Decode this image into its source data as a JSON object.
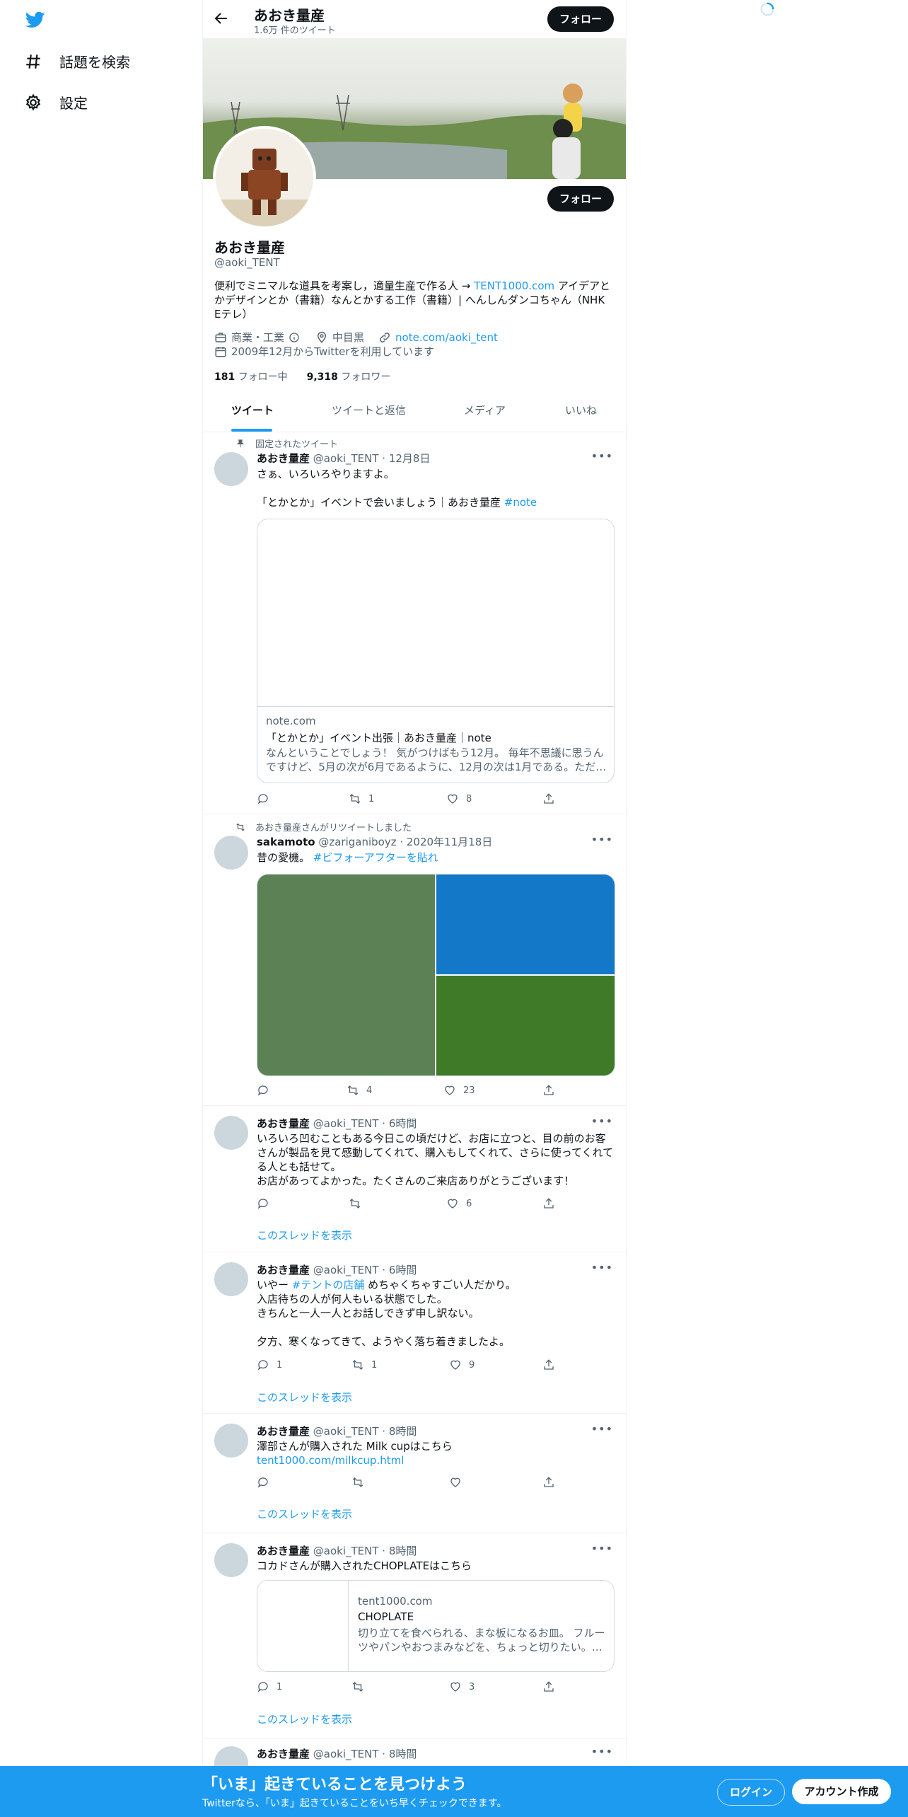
{
  "colors": {
    "accent": "#1d9bf0",
    "dark": "#0f1419",
    "muted": "#536471"
  },
  "nav": {
    "logo_icon": "twitter-bird-icon",
    "items": [
      {
        "icon": "hashtag-icon",
        "label": "話題を検索"
      },
      {
        "icon": "gear-icon",
        "label": "設定"
      }
    ]
  },
  "header": {
    "name": "あおき量産",
    "tweet_count": "1.6万 件のツイート",
    "follow": "フォロー"
  },
  "profile": {
    "name": "あおき量産",
    "handle": "@aoki_TENT",
    "follow": "フォロー",
    "bio_pre": "便利でミニマルな道具を考案し，適量生産で作る人 → ",
    "bio_link": "TENT1000.com",
    "bio_post": "  アイデアとかデザインとか（書籍）なんとかする工作（書籍）| へんしんダンコちゃん（NHK Eテレ）",
    "category": "商業・工業",
    "location": "中目黒",
    "website": "note.com/aoki_tent",
    "joined": "2009年12月からTwitterを利用しています",
    "following_count": "181",
    "following_label": "フォロー中",
    "followers_count": "9,318",
    "followers_label": "フォロワー"
  },
  "tabs": [
    "ツイート",
    "ツイートと返信",
    "メディア",
    "いいね"
  ],
  "tweets": [
    {
      "pinned_label": "固定されたツイート",
      "name": "あおき量産",
      "handle": "@aoki_TENT · 12月8日",
      "line1": "さぁ、いろいろやりますよ。",
      "line2": "「とかとか」イベントで会いましょう｜あおき量産 ",
      "hashtag": "#note",
      "card": {
        "domain": "note.com",
        "title": "「とかとか」イベント出張｜あおき量産｜note",
        "desc": "なんということでしょう！ 気がつけばもう12月。 毎年不思議に思うんですけど、5月の次が6月であるように、12月の次は1月である。ただ…"
      },
      "counts": {
        "reply": "",
        "retweet": "1",
        "like": "8"
      }
    },
    {
      "retweet_label": "あおき量産さんがリツイートしました",
      "name": "sakamoto",
      "handle": "@zariganiboyz · 2020年11月18日",
      "text": "昔の愛機。 ",
      "hashtag": "#ビフォーアフターを貼れ",
      "media_colors": [
        "#5b8155",
        "#1478c8",
        "#3f7a28"
      ],
      "counts": {
        "reply": "",
        "retweet": "4",
        "like": "23"
      }
    },
    {
      "name": "あおき量産",
      "handle": "@aoki_TENT · 6時間",
      "text1": "いろいろ凹むこともある今日この頃だけど、お店に立つと、目の前のお客さんが製品を見て感動してくれて、購入もしてくれて、さらに使ってくれてる人とも話せて。",
      "text2": "お店があってよかった。たくさんのご来店ありがとうございます！",
      "counts": {
        "reply": "",
        "retweet": "",
        "like": "6"
      },
      "thread": "このスレッドを表示"
    },
    {
      "name": "あおき量産",
      "handle": "@aoki_TENT · 6時間",
      "pre": "いやー ",
      "hashtag": "#テントの店舗",
      "post": " めちゃくちゃすごい人だかり。",
      "line2": "入店待ちの人が何人もいる状態でした。",
      "line3": "きちんと一人一人とお話しできず申し訳ない。",
      "line4": "夕方、寒くなってきて、ようやく落ち着きましたよ。",
      "counts": {
        "reply": "1",
        "retweet": "1",
        "like": "9"
      },
      "thread": "このスレッドを表示"
    },
    {
      "name": "あおき量産",
      "handle": "@aoki_TENT · 8時間",
      "text": "澤部さんが購入された Milk cupはこちら",
      "link": "tent1000.com/milkcup.html",
      "counts": {
        "reply": "",
        "retweet": "",
        "like": ""
      },
      "thread": "このスレッドを表示"
    },
    {
      "name": "あおき量産",
      "handle": "@aoki_TENT · 8時間",
      "text": "コカドさんが購入されたCHOPLATEはこちら",
      "card": {
        "domain": "tent1000.com",
        "title": "CHOPLATE",
        "desc": "切り立てを食べられる、まな板になるお皿。 フルーツやパンやおつまみなどを、ちょっと切りたい。…"
      },
      "counts": {
        "reply": "1",
        "retweet": "",
        "like": "3"
      },
      "thread": "このスレッドを表示"
    },
    {
      "name": "あおき量産",
      "handle": "@aoki_TENT · 8時間"
    }
  ],
  "bottom": {
    "title": "「いま」起きていることを見つけよう",
    "subtitle": "Twitterなら、「いま」起きていることをいち早くチェックできます。",
    "login": "ログイン",
    "signup": "アカウント作成"
  }
}
